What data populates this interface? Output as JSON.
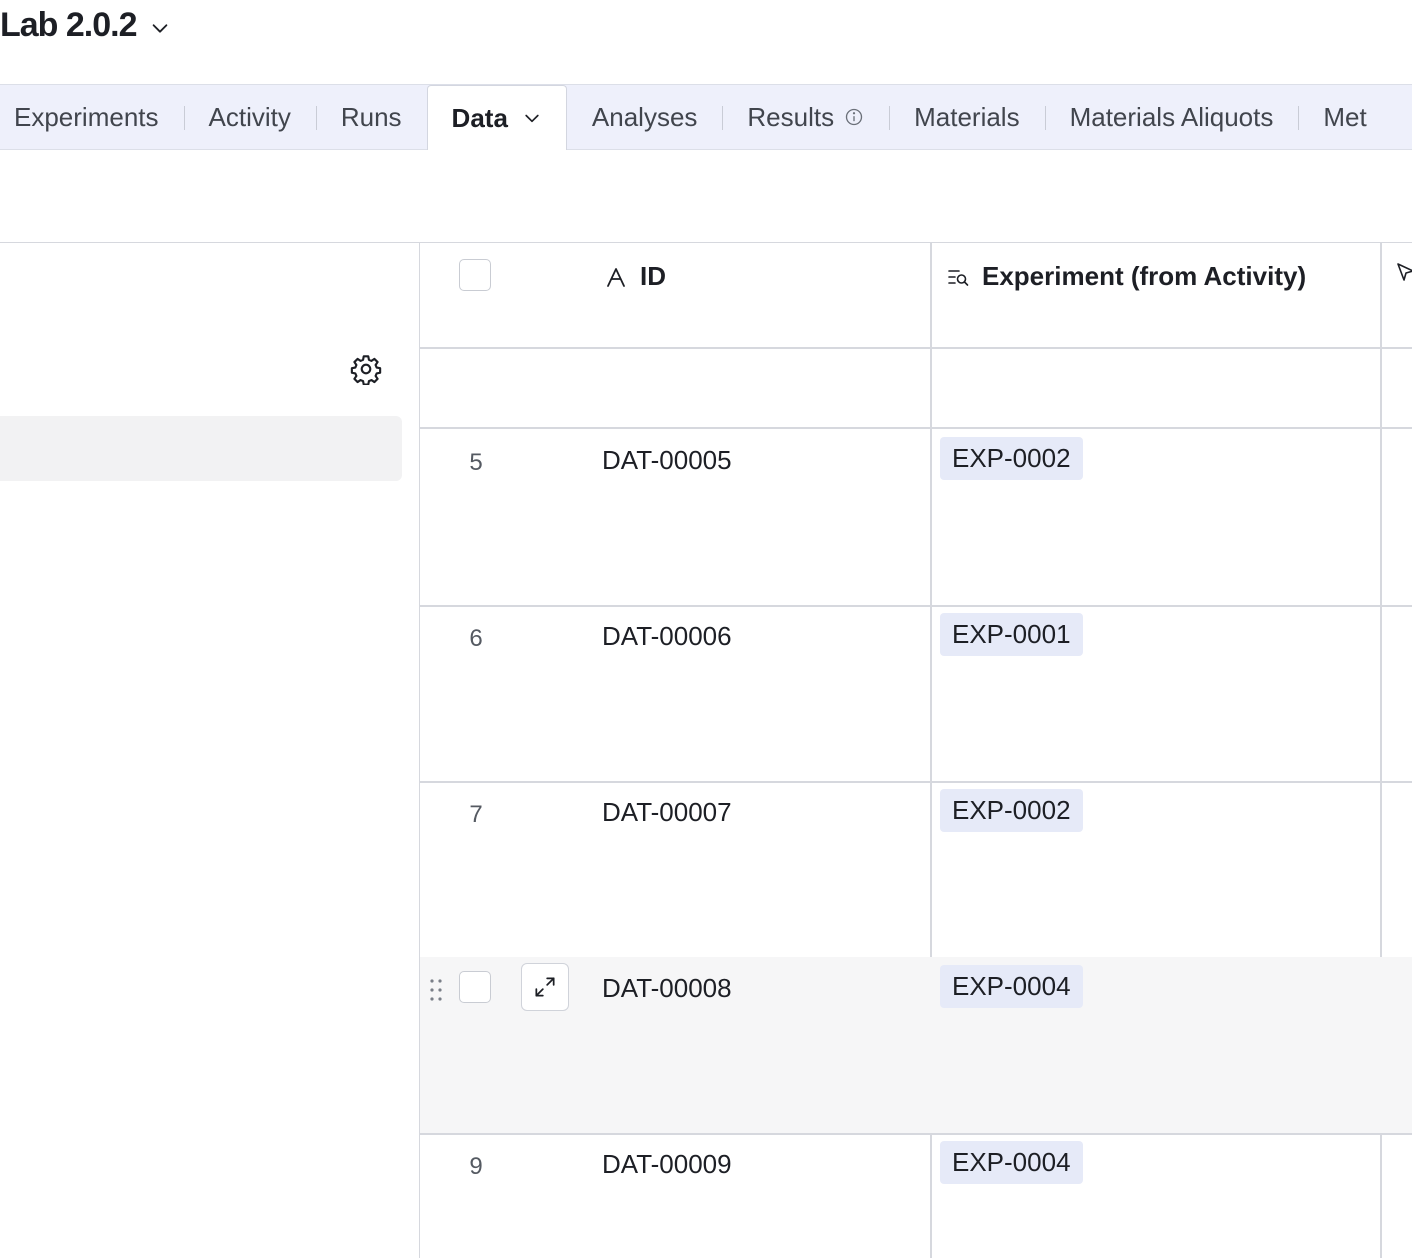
{
  "base": {
    "title": "Lab 2.0.2"
  },
  "tabs": [
    {
      "label": "Experiments"
    },
    {
      "label": "Activity"
    },
    {
      "label": "Runs"
    },
    {
      "label": "Data",
      "active": true
    },
    {
      "label": "Analyses"
    },
    {
      "label": "Results"
    },
    {
      "label": "Materials"
    },
    {
      "label": "Materials Aliquots"
    },
    {
      "label": "Met"
    }
  ],
  "grid": {
    "columns": [
      {
        "label": "ID",
        "icon": "primary-field-icon"
      },
      {
        "label": "Experiment (from Activity)",
        "icon": "lookup-icon"
      },
      {
        "label": "",
        "icon": "cursor-icon"
      }
    ],
    "rows": [
      {
        "num": "5",
        "id": "DAT-00005",
        "experiment": "EXP-0002"
      },
      {
        "num": "6",
        "id": "DAT-00006",
        "experiment": "EXP-0001"
      },
      {
        "num": "7",
        "id": "DAT-00007",
        "experiment": "EXP-0002"
      },
      {
        "num": "",
        "id": "DAT-00008",
        "experiment": "EXP-0004",
        "hovered": true
      },
      {
        "num": "9",
        "id": "DAT-00009",
        "experiment": "EXP-0004"
      }
    ]
  },
  "colors": {
    "tabbar_bg": "#eef0fb",
    "chip_bg": "#e6eaf8",
    "hover_row_bg": "#f6f6f7"
  }
}
